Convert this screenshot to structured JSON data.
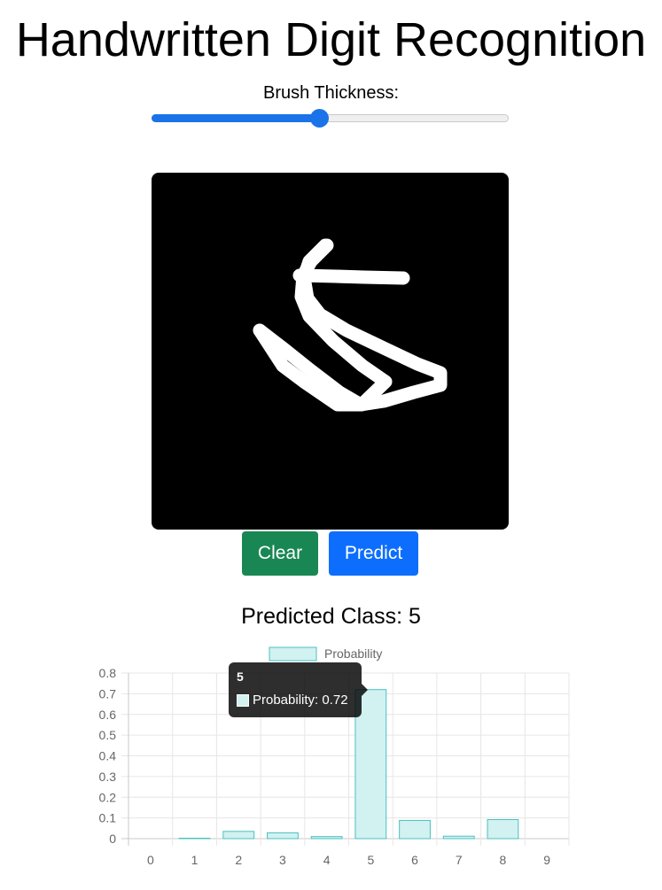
{
  "app": {
    "title": "Handwritten Digit Recognition"
  },
  "brush": {
    "label": "Brush Thickness:",
    "value_fraction": 0.47
  },
  "buttons": {
    "clear_label": "Clear",
    "predict_label": "Predict"
  },
  "prediction": {
    "text": "Predicted Class: 5"
  },
  "colors": {
    "canvas_background": "#000000",
    "stroke": "#ffffff",
    "clear_button": "#198754",
    "predict_button": "#0d6efd",
    "slider_accent": "#1a73e8",
    "bar_fill": "#d2f1f1",
    "bar_border": "#4bc0c0"
  },
  "tooltip": {
    "title": "5",
    "body": "Probability: 0.72"
  },
  "chart_data": {
    "type": "bar",
    "categories": [
      "0",
      "1",
      "2",
      "3",
      "4",
      "5",
      "6",
      "7",
      "8",
      "9"
    ],
    "series": [
      {
        "name": "Probability",
        "values": [
          0.0,
          0.002,
          0.035,
          0.028,
          0.01,
          0.72,
          0.088,
          0.012,
          0.092,
          0.0
        ]
      }
    ],
    "ylim": [
      0,
      0.8
    ],
    "yticks": [
      "0",
      "0.1",
      "0.2",
      "0.3",
      "0.4",
      "0.5",
      "0.6",
      "0.7",
      "0.8"
    ],
    "grid": true,
    "legend_position": "top"
  }
}
